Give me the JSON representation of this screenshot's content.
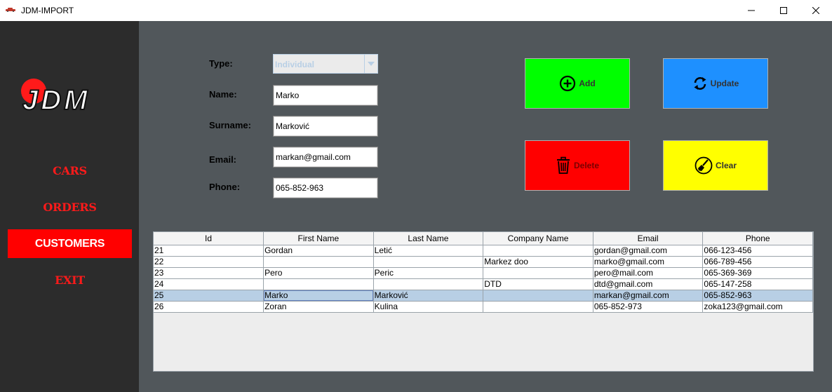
{
  "window": {
    "title": "JDM-IMPORT",
    "icon": "car-icon"
  },
  "sidebar": {
    "logo_text": "JDM",
    "items": [
      {
        "label": "CARS",
        "active": false
      },
      {
        "label": "ORDERS",
        "active": false
      },
      {
        "label": "CUSTOMERS",
        "active": true
      },
      {
        "label": "EXIT",
        "active": false
      }
    ]
  },
  "form": {
    "type_label": "Type:",
    "type_value": "Individual",
    "name_label": "Name:",
    "name_value": "Marko",
    "surname_label": "Surname:",
    "surname_value": "Marković",
    "email_label": "Email:",
    "email_value": "markan@gmail.com",
    "phone_label": "Phone:",
    "phone_value": "065-852-963"
  },
  "buttons": {
    "add": "Add",
    "update": "Update",
    "delete": "Delete",
    "clear": "Clear"
  },
  "table": {
    "columns": [
      "Id",
      "First Name",
      "Last Name",
      "Company Name",
      "Email",
      "Phone"
    ],
    "rows": [
      [
        "21",
        "Gordan",
        "Letić",
        "",
        "gordan@gmail.com",
        "066-123-456"
      ],
      [
        "22",
        "",
        "",
        "Markez doo",
        "marko@gmail.com",
        "066-789-456"
      ],
      [
        "23",
        "Pero",
        "Peric",
        "",
        "pero@mail.com",
        "065-369-369"
      ],
      [
        "24",
        "",
        "",
        "DTD",
        "dtd@gmail.com",
        "065-147-258"
      ],
      [
        "25",
        "Marko",
        "Marković",
        "",
        "markan@gmail.com",
        "065-852-963"
      ],
      [
        "26",
        "Zoran",
        "Kulina",
        "",
        "065-852-973",
        "zoka123@gmail.com"
      ]
    ],
    "selected_row": 4
  },
  "colors": {
    "sidebar_bg": "#2c2c2c",
    "main_bg": "#51575b",
    "accent_red": "#ff0000",
    "add_green": "#00ff00",
    "update_blue": "#1e90ff",
    "clear_yellow": "#ffff00",
    "selection": "#b8cfe5"
  }
}
